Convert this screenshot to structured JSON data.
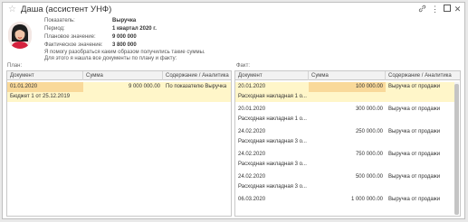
{
  "window": {
    "title": "Даша (ассистент УНФ)"
  },
  "info": {
    "rows": [
      {
        "label": "Показатель:",
        "value": "Выручка"
      },
      {
        "label": "Период:",
        "value": "1 квартал 2020 г."
      },
      {
        "label": "Плановое значение:",
        "value": "9 000 000"
      },
      {
        "label": "Фактическое значение:",
        "value": "3 800 000"
      }
    ],
    "message_line1": "Я помогу разобраться каким образом получились такие суммы.",
    "message_line2": "Для этого я нашла все документы по плану и факту:"
  },
  "plan": {
    "label": "План:",
    "columns": [
      "Документ",
      "Сумма",
      "Содержание / Аналитика"
    ],
    "rows": [
      {
        "document": "01.01.2020",
        "sum": "9 000 000.00",
        "content": "По показателю Выручка"
      },
      {
        "document": "Бюджет 1 от 25.12.2019",
        "sum": "",
        "content": ""
      }
    ]
  },
  "fact": {
    "label": "Факт:",
    "columns": [
      "Документ",
      "Сумма",
      "Содержание / Аналитика"
    ],
    "rows": [
      {
        "document": "20.01.2020",
        "sum": "100 000.00",
        "content": "Выручка от продажи"
      },
      {
        "document": "Расходная накладная 1 о...",
        "sum": "",
        "content": ""
      },
      {
        "document": "20.01.2020",
        "sum": "300 000.00",
        "content": "Выручка от продажи"
      },
      {
        "document": "Расходная накладная 1 о...",
        "sum": "",
        "content": ""
      },
      {
        "document": "24.02.2020",
        "sum": "250 000.00",
        "content": "Выручка от продажи"
      },
      {
        "document": "Расходная накладная 3 о...",
        "sum": "",
        "content": ""
      },
      {
        "document": "24.02.2020",
        "sum": "750 000.00",
        "content": "Выручка от продажи"
      },
      {
        "document": "Расходная накладная 3 о...",
        "sum": "",
        "content": ""
      },
      {
        "document": "24.02.2020",
        "sum": "500 000.00",
        "content": "Выручка от продажи"
      },
      {
        "document": "Расходная накладная 3 о...",
        "sum": "",
        "content": ""
      },
      {
        "document": "06.03.2020",
        "sum": "1 000 000.00",
        "content": "Выручка от продажи"
      }
    ]
  }
}
